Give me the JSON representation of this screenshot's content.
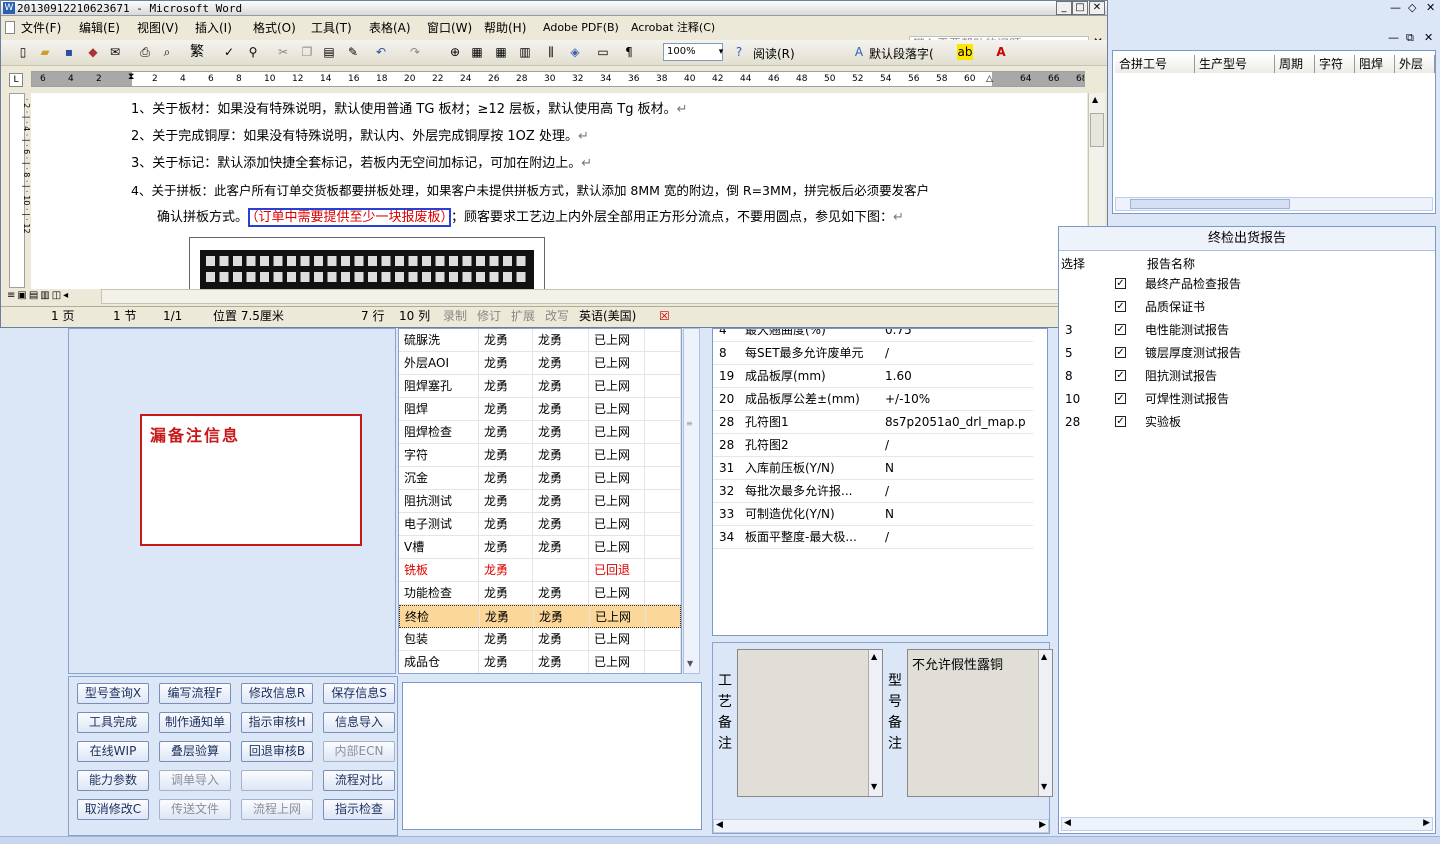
{
  "word": {
    "title": "20130912210623671 - Microsoft Word",
    "menu": [
      "文件(F)",
      "编辑(E)",
      "视图(V)",
      "插入(I)",
      "格式(O)",
      "工具(T)",
      "表格(A)",
      "窗口(W)",
      "帮助(H)",
      "Adobe PDF(B)",
      "Acrobat 注释(C)"
    ],
    "help_placeholder": "键入需要帮助的问题",
    "zoom": "100%",
    "read_label": "阅读(R)",
    "style_value": "默认段落字(",
    "ruler_left": [
      "6",
      "4",
      "2"
    ],
    "ruler_nums": [
      "2",
      "4",
      "6",
      "8",
      "10",
      "12",
      "14",
      "16",
      "18",
      "20",
      "22",
      "24",
      "26",
      "28",
      "30",
      "32",
      "34",
      "36",
      "38",
      "40",
      "42",
      "44",
      "46",
      "48",
      "50",
      "52",
      "54",
      "56",
      "58",
      "60",
      "64",
      "66",
      "68"
    ],
    "lines": [
      "1、关于板材：如果没有特殊说明，默认使用普通 TG 板材；≥12 层板，默认使用高 Tg 板材。",
      "2、关于完成铜厚：如果没有特殊说明，默认内、外层完成铜厚按 1OZ 处理。",
      "3、关于标记：默认添加快捷全套标记，若板内无空间加标记，可加在附边上。",
      "4、关于拼板：此客户所有订单交货板都要拼板处理，如果客户未提供拼板方式，默认添加 8MM 宽的附边，倒 R=3MM，拼完板后必须要发客户"
    ],
    "line5_a": "确认拼板方式。",
    "line5_highlight": "（订单中需要提供至少一块报废板）",
    "line5_b": "；顾客要求工艺边上内外层全部用正方形分流点，不要用圆点，参见如下图：",
    "status": {
      "page": "1 页",
      "section": "1 节",
      "pages": "1/1",
      "position": "位置 7.5厘米",
      "line": "7 行",
      "col": "10 列",
      "rec": "录制",
      "rev": "修订",
      "ext": "扩展",
      "ovr": "改写",
      "lang": "英语(美国)"
    }
  },
  "top_grid": {
    "headers": [
      "合拼工号",
      "生产型号",
      "周期",
      "字符",
      "阻焊",
      "外层"
    ]
  },
  "note_label": "漏备注信息",
  "process_rows": [
    {
      "name": "硫脲洗",
      "a": "龙勇",
      "b": "龙勇",
      "s": "已上网"
    },
    {
      "name": "外层AOI",
      "a": "龙勇",
      "b": "龙勇",
      "s": "已上网"
    },
    {
      "name": "阻焊塞孔",
      "a": "龙勇",
      "b": "龙勇",
      "s": "已上网"
    },
    {
      "name": "阻焊",
      "a": "龙勇",
      "b": "龙勇",
      "s": "已上网"
    },
    {
      "name": "阻焊检查",
      "a": "龙勇",
      "b": "龙勇",
      "s": "已上网"
    },
    {
      "name": "字符",
      "a": "龙勇",
      "b": "龙勇",
      "s": "已上网"
    },
    {
      "name": "沉金",
      "a": "龙勇",
      "b": "龙勇",
      "s": "已上网"
    },
    {
      "name": "阻抗测试",
      "a": "龙勇",
      "b": "龙勇",
      "s": "已上网"
    },
    {
      "name": "电子测试",
      "a": "龙勇",
      "b": "龙勇",
      "s": "已上网"
    },
    {
      "name": "V槽",
      "a": "龙勇",
      "b": "龙勇",
      "s": "已上网"
    },
    {
      "name": "铣板",
      "a": "龙勇",
      "b": "",
      "s": "已回退"
    },
    {
      "name": "功能检查",
      "a": "龙勇",
      "b": "龙勇",
      "s": "已上网"
    },
    {
      "name": "终检",
      "a": "龙勇",
      "b": "龙勇",
      "s": "已上网"
    },
    {
      "name": "包装",
      "a": "龙勇",
      "b": "龙勇",
      "s": "已上网"
    },
    {
      "name": "成品仓",
      "a": "龙勇",
      "b": "龙勇",
      "s": "已上网"
    }
  ],
  "buttons": [
    [
      "型号查询X",
      "编写流程F",
      "修改信息R",
      "保存信息S"
    ],
    [
      "工具完成",
      "制作通知单",
      "指示审核H",
      "信息导入"
    ],
    [
      "在线WIP",
      "叠层验算",
      "回退审核B",
      "内部ECN"
    ],
    [
      "能力参数",
      "调单导入",
      "",
      "流程对比"
    ],
    [
      "取消修改C",
      "传送文件",
      "流程上网",
      "指示检查"
    ]
  ],
  "params": [
    {
      "n": "4",
      "k": "最大翘曲度(%)",
      "v": "0.75"
    },
    {
      "n": "8",
      "k": "每SET最多允许废单元",
      "v": "/"
    },
    {
      "n": "19",
      "k": "成品板厚(mm)",
      "v": "1.60"
    },
    {
      "n": "20",
      "k": "成品板厚公差±(mm)",
      "v": "+/-10%"
    },
    {
      "n": "28",
      "k": "孔符图1",
      "v": "8s7p2051a0_drl_map.p"
    },
    {
      "n": "28",
      "k": "孔符图2",
      "v": "/"
    },
    {
      "n": "31",
      "k": "入库前压板(Y/N)",
      "v": "N"
    },
    {
      "n": "32",
      "k": "每批次最多允许报...",
      "v": "/"
    },
    {
      "n": "33",
      "k": "可制造优化(Y/N)",
      "v": "N"
    },
    {
      "n": "34",
      "k": "板面平整度-最大极...",
      "v": "/"
    }
  ],
  "notes": {
    "craft_label": "工艺备注",
    "model_label": "型号备注",
    "model_text": "不允许假性露铜"
  },
  "reports": {
    "title": "终检出货报告",
    "col_select": "选择",
    "col_name": "报告名称",
    "rows": [
      {
        "n": "",
        "name": "最终产品检查报告"
      },
      {
        "n": "",
        "name": "品质保证书"
      },
      {
        "n": "3",
        "name": "电性能测试报告"
      },
      {
        "n": "5",
        "name": "镀层厚度测试报告"
      },
      {
        "n": "8",
        "name": "阻抗测试报告"
      },
      {
        "n": "10",
        "name": "可焊性测试报告"
      },
      {
        "n": "28",
        "name": "实验板"
      }
    ]
  }
}
